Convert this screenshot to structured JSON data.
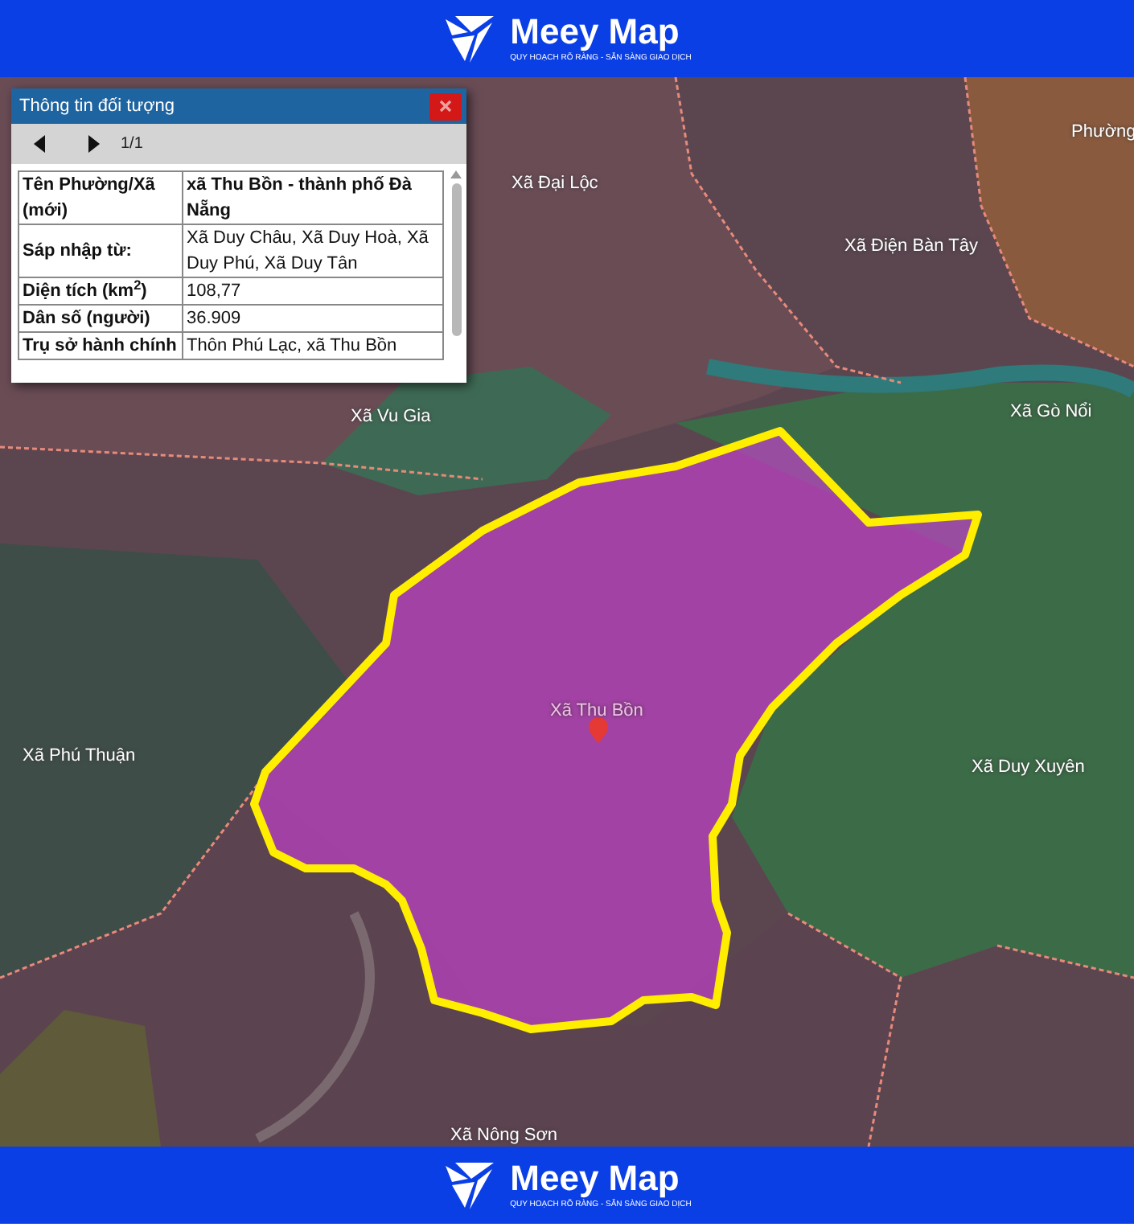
{
  "header": {
    "brand": "Meey Map",
    "tagline": "QUY HOẠCH RÕ RÀNG - SẴN SÀNG GIAO DỊCH"
  },
  "info_panel": {
    "title": "Thông tin đối tượng",
    "pager": "1/1",
    "rows": [
      {
        "label": "Tên Phường/Xã (mới)",
        "value": "xã Thu Bồn - thành phố Đà Nẵng",
        "value_bold": true
      },
      {
        "label": "Sáp nhập từ:",
        "value": "Xã Duy Châu, Xã Duy Hoà, Xã Duy Phú, Xã Duy Tân",
        "value_bold": false
      },
      {
        "label": "Diện tích (km$^{2}$)",
        "value": "108,77",
        "value_bold": false
      },
      {
        "label": "Dân số (người)",
        "value": "36.909",
        "value_bold": false
      },
      {
        "label": "Trụ sở hành chính",
        "value": "Thôn Phú Lạc, xã Thu Bồn",
        "value_bold": false
      }
    ]
  },
  "map_labels": [
    {
      "text": "Phường",
      "kind": "commune"
    },
    {
      "text": "Xã Đại Lộc",
      "kind": "commune"
    },
    {
      "text": "Xã Điện Bàn Tây",
      "kind": "commune"
    },
    {
      "text": "Xã Vu Gia",
      "kind": "commune"
    },
    {
      "text": "Xã Gò Nổi",
      "kind": "commune"
    },
    {
      "text": "Xã Thu Bồn",
      "kind": "selected"
    },
    {
      "text": "Xã Phú Thuận",
      "kind": "commune"
    },
    {
      "text": "Xã Duy Xuyên",
      "kind": "commune"
    },
    {
      "text": "Xã Nông Sơn",
      "kind": "commune"
    }
  ],
  "footer": {
    "brand": "Meey Map",
    "tagline": "QUY HOẠCH RÕ RÀNG - SẴN SÀNG GIAO DỊCH"
  }
}
